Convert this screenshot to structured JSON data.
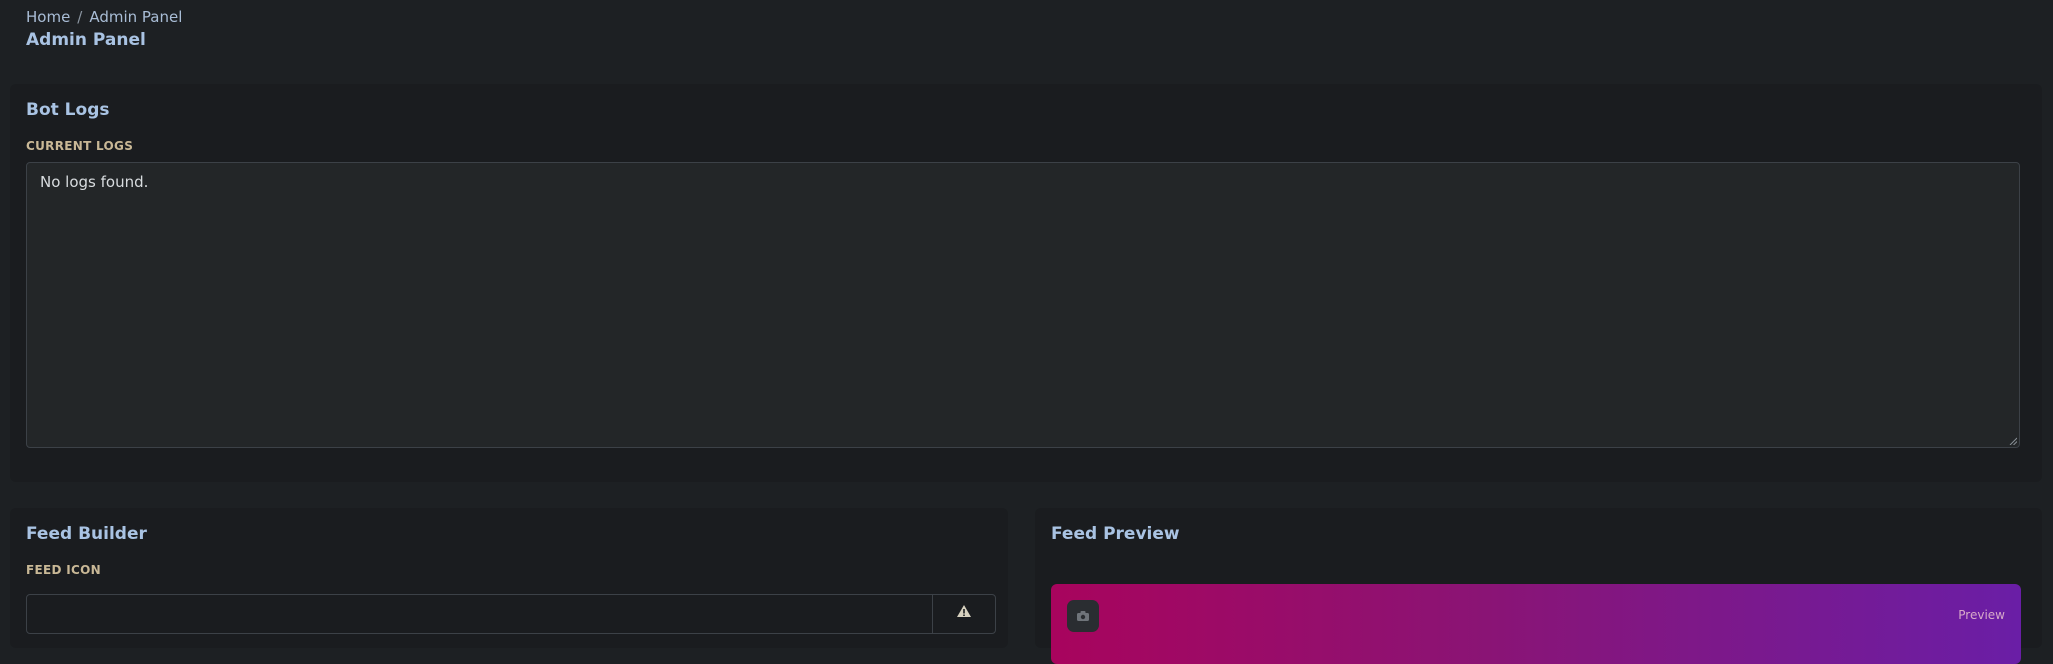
{
  "breadcrumb": {
    "home": "Home",
    "separator": "/",
    "current": "Admin Panel"
  },
  "page_title": "Admin Panel",
  "bot_logs": {
    "title": "Bot Logs",
    "label": "CURRENT LOGS",
    "content": "No logs found."
  },
  "feed_builder": {
    "title": "Feed Builder",
    "icon_label": "FEED ICON",
    "icon_value": "",
    "addon_icon": "warning-icon"
  },
  "feed_preview": {
    "title": "Feed Preview",
    "badge": "Preview",
    "avatar_icon": "camera-icon",
    "gradient_start": "#a8045d",
    "gradient_end": "#6a1ea6"
  }
}
